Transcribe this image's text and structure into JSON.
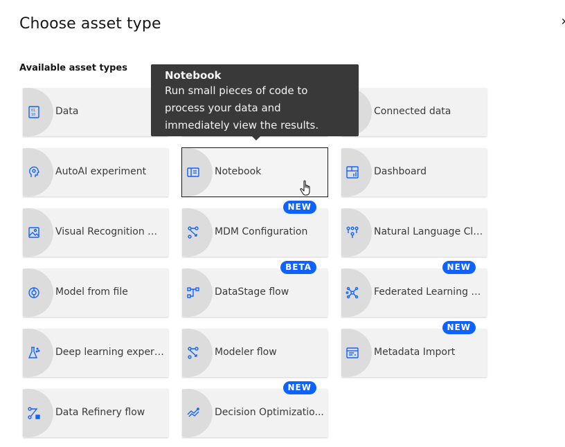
{
  "dialog": {
    "title": "Choose asset type",
    "section_label": "Available asset types",
    "close_icon": "close-icon"
  },
  "tooltip": {
    "title": "Notebook",
    "body": "Run small pieces of code to process your data and immediately view the results."
  },
  "tiles": [
    {
      "label": "Data",
      "icon": "data-icon"
    },
    {
      "label": "",
      "icon": "hidden"
    },
    {
      "label": "Connected data",
      "icon": "connected-data-icon"
    },
    {
      "label": "AutoAI experiment",
      "icon": "autoai-icon"
    },
    {
      "label": "Notebook",
      "icon": "notebook-icon",
      "selected": true
    },
    {
      "label": "Dashboard",
      "icon": "dashboard-icon"
    },
    {
      "label": "Visual Recognition m...",
      "icon": "visual-recognition-icon"
    },
    {
      "label": "MDM Configuration",
      "icon": "mdm-icon",
      "badge": "NEW"
    },
    {
      "label": "Natural Language Cla...",
      "icon": "nlc-icon"
    },
    {
      "label": "Model from file",
      "icon": "model-icon"
    },
    {
      "label": "DataStage flow",
      "icon": "datastage-icon",
      "badge": "BETA"
    },
    {
      "label": "Federated Learning e...",
      "icon": "federated-icon",
      "badge": "NEW"
    },
    {
      "label": "Deep learning experi...",
      "icon": "flask-icon"
    },
    {
      "label": "Modeler flow",
      "icon": "modeler-icon"
    },
    {
      "label": "Metadata Import",
      "icon": "metadata-icon",
      "badge": "NEW"
    },
    {
      "label": "Data Refinery flow",
      "icon": "refinery-icon"
    },
    {
      "label": "Decision Optimizatio...",
      "icon": "decision-icon",
      "badge": "NEW"
    }
  ],
  "colors": {
    "accent": "#0f62fe",
    "tile_bg": "#f2f2f2",
    "tooltip_bg": "#393939"
  }
}
